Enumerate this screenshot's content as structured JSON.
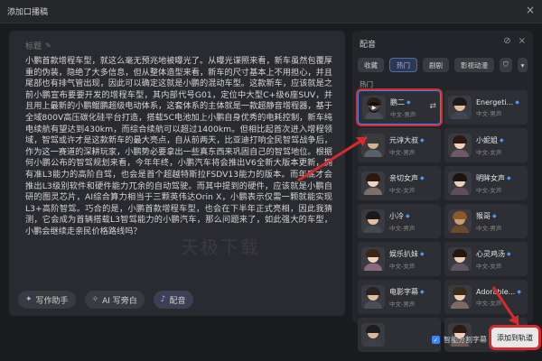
{
  "window": {
    "title": "添加口播稿",
    "close_icon": "×"
  },
  "editor": {
    "title_placeholder": "标题",
    "body": "小鹏首款增程车型，就这么毫无预兆地被曝光了。从曝光谍照来看，新车虽然包覆厚重的伪装，隐绝了大多信息，但从整体造型来看，新车的尺寸基本上不用担心，并且尾部也有排气管出现，因此可以确定这就是小鹏的混动车型。这款新车，应该就是之前小鹏宣布要要开发的增程车型，其内部代号G01，定位中大型C+级6座SUV，并且用上最新的小鹏鲲鹏超级电动体系，这套体系的主体就是一款超静音增程器，基于全域800V高压碳化硅平台打造，搭载5C电池加上小鹏自身优秀的电耗控制，新车纯电续航有望达到430km，而综合续航可以超过1400km。但相比起首次进入增程领域，智驾或许才是这款新车的最大亮点，自从前两天，比亚迪打响全民智驾战争后，作为这一赛道的深耕玩家，小鹏势必要拿出一些真东西来巩固自己的智驾地位。根据何小鹏公布的智驾规划来看，今年年终，小鹏汽车将会推出V6全新大版本更新，拥有准L3能力的高阶自驾，也会是首个超越特斯拉FSDV13能力的版本。而年底才会推出L3级别软件和硬件能力兀余的自动驾驶。而其中提到的硬件，应该就是小鹏自研的图灵芯片，AI综合算力相当于三颗英伟达Orin X，小鹏表示仅需一颗就能实现L3+高阶智驾。巧合的是，小鹏首款增程车型，也会在下半年正式亮相，因此我猜测，它会成为首辆搭载L3智驾能力的小鹏汽车，那么问题来了，如此强大的车型，小鹏会继续走亲民价格路线吗？"
  },
  "toolbar": {
    "writing_assistant": "写作助手",
    "ai_narration": "AI 写旁白",
    "dubbing": "配音"
  },
  "panel": {
    "title": "配音",
    "tabs": [
      "收藏",
      "热门",
      "剧剧",
      "影视动漫"
    ],
    "active_tab": "热门",
    "section_label": "热门",
    "voices": [
      {
        "name": "鹏二",
        "sub": "中文-男声",
        "selected": true,
        "skin": "#e0b48e",
        "hair": "#2a1e16",
        "shirt": "#4a4d55"
      },
      {
        "name": "Energeti...",
        "sub": "中文-男声",
        "selected": false,
        "skin": "#e3bd9c",
        "hair": "#1e1a18",
        "shirt": "#3f4652"
      },
      {
        "name": "元谆大叔",
        "sub": "中文-男声",
        "selected": false,
        "skin": "#d8b090",
        "hair": "#3a3a3a",
        "shirt": "#5a5f6a"
      },
      {
        "name": "小妮姐",
        "sub": "中文-女声",
        "selected": false,
        "skin": "#efd0b8",
        "hair": "#2b1b14",
        "shirt": "#6e5a66"
      },
      {
        "name": "亲切女声",
        "sub": "中文-女声",
        "selected": false,
        "skin": "#f0d2bb",
        "hair": "#2a1a12",
        "shirt": "#7a6f6a"
      },
      {
        "name": "明眸女声",
        "sub": "中文-女声",
        "selected": false,
        "skin": "#eecfb6",
        "hair": "#1d1410",
        "shirt": "#5c4f58"
      },
      {
        "name": "小冷",
        "sub": "中文-男声",
        "selected": false,
        "skin": "#e2c0a0",
        "hair": "#1a1a1a",
        "shirt": "#44484f"
      },
      {
        "name": "猴哥",
        "sub": "中文-男声",
        "selected": false,
        "skin": "#c8a070",
        "hair": "#8a5a2a",
        "shirt": "#6a4a2a"
      },
      {
        "name": "娱乐扒妹",
        "sub": "中文-女声",
        "selected": false,
        "skin": "#f1d4bd",
        "hair": "#3a2618",
        "shirt": "#8a6a7a"
      },
      {
        "name": "心灵鸡汤",
        "sub": "中文-女声",
        "selected": false,
        "skin": "#eccdb3",
        "hair": "#241710",
        "shirt": "#5e5560"
      },
      {
        "name": "电影字幕",
        "sub": "中文-男声",
        "selected": false,
        "skin": "#dfbc9a",
        "hair": "#2a2222",
        "shirt": "#4b4e56"
      },
      {
        "name": "Adorable...",
        "sub": "中文-女声",
        "selected": false,
        "skin": "#f0d0b4",
        "hair": "#3b2a1c",
        "shirt": "#7d6a62"
      },
      {
        "name": "",
        "sub": "",
        "selected": false,
        "skin": "#dcb797",
        "hair": "#1e1e1e",
        "shirt": "#3d4048"
      },
      {
        "name": "",
        "sub": "",
        "selected": false,
        "skin": "#efcfb5",
        "hair": "#2c1c12",
        "shirt": "#6a5a5a"
      }
    ]
  },
  "footer": {
    "smart_subtitles": "智能分割字幕",
    "add_button": "添加到轨道"
  },
  "watermark": "天极下载",
  "colors": {
    "accent": "#3a84ff",
    "highlight": "#d62b2b"
  }
}
